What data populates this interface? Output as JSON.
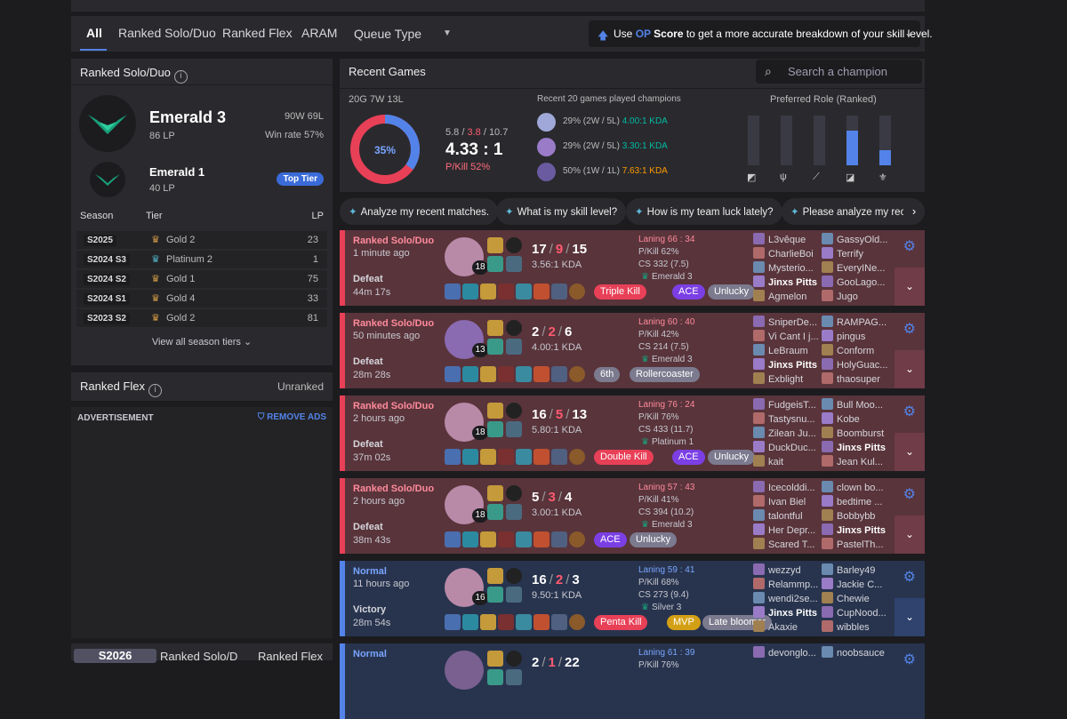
{
  "tabs": [
    "All",
    "Ranked Solo/Duo",
    "Ranked Flex",
    "ARAM"
  ],
  "queue_type": "Queue Type",
  "op_note": {
    "pre": "Use ",
    "op": "OP",
    "mid": " Score to get a more accurate breakdown of your skill level."
  },
  "ranked_solo": {
    "title": "Ranked Solo/Duo",
    "tier": "Emerald 3",
    "lp": "86 LP",
    "record": "90W 69L",
    "winrate": "Win rate 57%",
    "peak_tier": "Emerald 1",
    "peak_lp": "40 LP",
    "top_tier": "Top Tier",
    "headers": [
      "Season",
      "Tier",
      "LP"
    ],
    "seasons": [
      {
        "season": "S2025",
        "tier": "Gold 2",
        "lp": "23"
      },
      {
        "season": "S2024 S3",
        "tier": "Platinum 2",
        "lp": "1"
      },
      {
        "season": "S2024 S2",
        "tier": "Gold 1",
        "lp": "75"
      },
      {
        "season": "S2024 S1",
        "tier": "Gold 4",
        "lp": "33"
      },
      {
        "season": "S2023 S2",
        "tier": "Gold 2",
        "lp": "81"
      }
    ],
    "view_all": "View all season tiers"
  },
  "ranked_flex": {
    "title": "Ranked Flex",
    "status": "Unranked"
  },
  "ad": {
    "label": "ADVERTISEMENT",
    "remove": "REMOVE ADS"
  },
  "bottom_tabs": [
    "S2026",
    "Ranked Solo/D",
    "Ranked Flex"
  ],
  "recent": {
    "title": "Recent Games",
    "search_placeholder": "Search a champion",
    "summary": "20G 7W 13L",
    "winrate_pct": 35,
    "winrate_label": "35%",
    "avg_k": "5.8",
    "avg_d": "3.8",
    "avg_a": "10.7",
    "kda": "4.33 : 1",
    "pkill": "P/Kill 52%",
    "champs_title": "Recent 20 games played champions",
    "champs": [
      {
        "pct": "29%",
        "rec": "(2W / 5L)",
        "kda": "4.00:1 KDA",
        "color": "#00bba3"
      },
      {
        "pct": "29%",
        "rec": "(2W / 5L)",
        "kda": "3.30:1 KDA",
        "color": "#00bba3"
      },
      {
        "pct": "50%",
        "rec": "(1W / 1L)",
        "kda": "7.63:1 KDA",
        "color": "#ff9b00"
      }
    ],
    "role_title": "Preferred Role (Ranked)",
    "roles": [
      {
        "name": "top-role-icon",
        "value": 0
      },
      {
        "name": "jungle-role-icon",
        "value": 0
      },
      {
        "name": "mid-role-icon",
        "value": 0
      },
      {
        "name": "bottom-role-icon",
        "value": 0.7
      },
      {
        "name": "support-role-icon",
        "value": 0.3
      }
    ]
  },
  "chips": [
    "Analyze my recent matches.",
    "What is my skill level?",
    "How is my team luck lately?",
    "Please analyze my recen"
  ],
  "games": [
    {
      "result": "loss",
      "queue": "Ranked Solo/Duo",
      "ago": "1 minute ago",
      "outcome": "Defeat",
      "duration": "44m 17s",
      "level": "18",
      "k": "17",
      "d": "9",
      "a": "15",
      "kda": "3.56:1 KDA",
      "laning": "Laning 66 : 34",
      "pkill": "P/Kill 62%",
      "cs": "CS 332 (7.5)",
      "rank": "Emerald 3",
      "badges": [
        {
          "t": "Triple Kill",
          "c": "red"
        },
        {
          "t": "ACE",
          "c": "purple"
        },
        {
          "t": "Unlucky",
          "c": "gray"
        }
      ],
      "team1": [
        "L3vêque",
        "CharlieBoi",
        "Mysterio...",
        "Jinxs Pitts",
        "Agmelon"
      ],
      "team2": [
        "GassyOld...",
        "Terrify",
        "EveryINe...",
        "GooLago...",
        "Jugo"
      ]
    },
    {
      "result": "loss",
      "queue": "Ranked Solo/Duo",
      "ago": "50 minutes ago",
      "outcome": "Defeat",
      "duration": "28m 28s",
      "level": "13",
      "k": "2",
      "d": "2",
      "a": "6",
      "kda": "4.00:1 KDA",
      "laning": "Laning 60 : 40",
      "pkill": "P/Kill 42%",
      "cs": "CS 214 (7.5)",
      "rank": "Emerald 3",
      "badges": [
        {
          "t": "6th",
          "c": "gray"
        },
        {
          "t": "Rollercoaster",
          "c": "gray"
        }
      ],
      "team1": [
        "SniperDe...",
        "Vi Cant I j...",
        "LeBraum",
        "Jinxs Pitts",
        "Exblight"
      ],
      "team2": [
        "RAMPAG...",
        "pingus",
        "Conform",
        "HolyGuac...",
        "thaosuper"
      ]
    },
    {
      "result": "loss",
      "queue": "Ranked Solo/Duo",
      "ago": "2 hours ago",
      "outcome": "Defeat",
      "duration": "37m 02s",
      "level": "18",
      "k": "16",
      "d": "5",
      "a": "13",
      "kda": "5.80:1 KDA",
      "laning": "Laning 76 : 24",
      "pkill": "P/Kill 76%",
      "cs": "CS 433 (11.7)",
      "rank": "Platinum 1",
      "badges": [
        {
          "t": "Double Kill",
          "c": "red"
        },
        {
          "t": "ACE",
          "c": "purple"
        },
        {
          "t": "Unlucky",
          "c": "gray"
        }
      ],
      "team1": [
        "FudgeisT...",
        "Tastysnu...",
        "Zilean Ju...",
        "DuckDuc...",
        "kait"
      ],
      "team2": [
        "Bull Moo...",
        "Kobe",
        "Boomburst",
        "Jinxs Pitts",
        "Jean Kul..."
      ]
    },
    {
      "result": "loss",
      "queue": "Ranked Solo/Duo",
      "ago": "2 hours ago",
      "outcome": "Defeat",
      "duration": "38m 43s",
      "level": "18",
      "k": "5",
      "d": "3",
      "a": "4",
      "kda": "3.00:1 KDA",
      "laning": "Laning 57 : 43",
      "pkill": "P/Kill 41%",
      "cs": "CS 394 (10.2)",
      "rank": "Emerald 3",
      "badges": [
        {
          "t": "ACE",
          "c": "purple"
        },
        {
          "t": "Unlucky",
          "c": "gray"
        }
      ],
      "team1": [
        "Icecolddi...",
        "Ivan Biel",
        "talontful",
        "Her Depr...",
        "Scared T..."
      ],
      "team2": [
        "clown bo...",
        "bedtime ...",
        "Bobbybb",
        "Jinxs Pitts",
        "PastelTh..."
      ]
    },
    {
      "result": "win",
      "queue": "Normal",
      "ago": "11 hours ago",
      "outcome": "Victory",
      "duration": "28m 54s",
      "level": "16",
      "k": "16",
      "d": "2",
      "a": "3",
      "kda": "9.50:1 KDA",
      "laning": "Laning 59 : 41",
      "pkill": "P/Kill 68%",
      "cs": "CS 273 (9.4)",
      "rank": "Silver 3",
      "badges": [
        {
          "t": "Penta Kill",
          "c": "red"
        },
        {
          "t": "MVP",
          "c": "gold"
        },
        {
          "t": "Late bloomer",
          "c": "gray"
        }
      ],
      "team1": [
        "wezzyd",
        "Relammp...",
        "wendi2se...",
        "Jinxs Pitts",
        "Akaxie"
      ],
      "team2": [
        "Barley49",
        "Jackie C...",
        "Chewie",
        "CupNood...",
        "wibbles"
      ]
    },
    {
      "result": "win",
      "queue": "Normal",
      "ago": "",
      "outcome": "",
      "duration": "",
      "level": "",
      "k": "2",
      "d": "1",
      "a": "22",
      "kda": "",
      "laning": "Laning 61 : 39",
      "pkill": "P/Kill 76%",
      "cs": "",
      "rank": "",
      "badges": [],
      "team1": [
        "devonglo..."
      ],
      "team2": [
        "noobsauce"
      ]
    }
  ],
  "me": "Jinxs Pitts"
}
